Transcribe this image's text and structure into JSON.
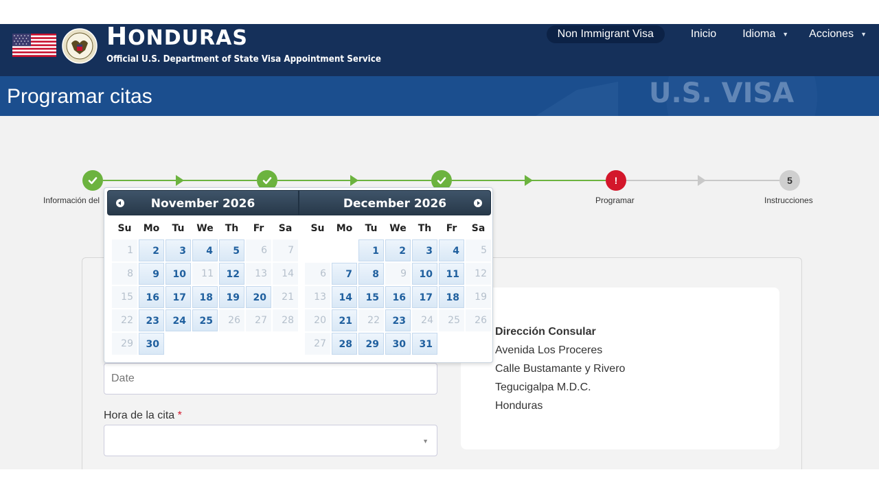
{
  "header": {
    "brand_first": "H",
    "brand_rest": "ONDURAS",
    "subtitle": "Official U.S. Department of State Visa Appointment Service",
    "nav": {
      "pill": "Non Immigrant Visa",
      "home": "Inicio",
      "language": "Idioma",
      "actions": "Acciones"
    },
    "watermark_text": "U.S. VISA"
  },
  "page": {
    "title": "Programar citas"
  },
  "stepper": {
    "steps": [
      {
        "label": "Información del",
        "status": "done"
      },
      {
        "label": "",
        "status": "done"
      },
      {
        "label": "",
        "status": "done"
      },
      {
        "label": "Programar",
        "status": "error",
        "mark": "!"
      },
      {
        "label": "Instrucciones",
        "status": "pending",
        "mark": "5"
      }
    ]
  },
  "datepicker": {
    "weekdays": [
      "Su",
      "Mo",
      "Tu",
      "We",
      "Th",
      "Fr",
      "Sa"
    ],
    "months": [
      {
        "title": "November 2026",
        "weeks": [
          [
            [
              "1",
              "off"
            ],
            [
              "2",
              "avail"
            ],
            [
              "3",
              "avail"
            ],
            [
              "4",
              "avail"
            ],
            [
              "5",
              "avail"
            ],
            [
              "6",
              "off"
            ],
            [
              "7",
              "off"
            ]
          ],
          [
            [
              "8",
              "off"
            ],
            [
              "9",
              "avail"
            ],
            [
              "10",
              "avail"
            ],
            [
              "11",
              "off"
            ],
            [
              "12",
              "avail"
            ],
            [
              "13",
              "off"
            ],
            [
              "14",
              "off"
            ]
          ],
          [
            [
              "15",
              "off"
            ],
            [
              "16",
              "avail"
            ],
            [
              "17",
              "avail"
            ],
            [
              "18",
              "avail"
            ],
            [
              "19",
              "avail"
            ],
            [
              "20",
              "avail"
            ],
            [
              "21",
              "off"
            ]
          ],
          [
            [
              "22",
              "off"
            ],
            [
              "23",
              "avail"
            ],
            [
              "24",
              "avail"
            ],
            [
              "25",
              "avail"
            ],
            [
              "26",
              "off"
            ],
            [
              "27",
              "off"
            ],
            [
              "28",
              "off"
            ]
          ],
          [
            [
              "29",
              "off"
            ],
            [
              "30",
              "avail"
            ],
            [
              "",
              ""
            ],
            [
              "",
              ""
            ],
            [
              "",
              ""
            ],
            [
              "",
              ""
            ],
            [
              "",
              ""
            ]
          ]
        ]
      },
      {
        "title": "December 2026",
        "weeks": [
          [
            [
              "",
              ""
            ],
            [
              "",
              ""
            ],
            [
              "1",
              "avail"
            ],
            [
              "2",
              "avail"
            ],
            [
              "3",
              "avail"
            ],
            [
              "4",
              "avail"
            ],
            [
              "5",
              "off"
            ]
          ],
          [
            [
              "6",
              "off"
            ],
            [
              "7",
              "avail"
            ],
            [
              "8",
              "avail"
            ],
            [
              "9",
              "off"
            ],
            [
              "10",
              "avail"
            ],
            [
              "11",
              "avail"
            ],
            [
              "12",
              "off"
            ]
          ],
          [
            [
              "13",
              "off"
            ],
            [
              "14",
              "avail"
            ],
            [
              "15",
              "avail"
            ],
            [
              "16",
              "avail"
            ],
            [
              "17",
              "avail"
            ],
            [
              "18",
              "avail"
            ],
            [
              "19",
              "off"
            ]
          ],
          [
            [
              "20",
              "off"
            ],
            [
              "21",
              "avail"
            ],
            [
              "22",
              "off"
            ],
            [
              "23",
              "avail"
            ],
            [
              "24",
              "off"
            ],
            [
              "25",
              "off"
            ],
            [
              "26",
              "off"
            ]
          ],
          [
            [
              "27",
              "off"
            ],
            [
              "28",
              "avail"
            ],
            [
              "29",
              "avail"
            ],
            [
              "30",
              "avail"
            ],
            [
              "31",
              "avail"
            ],
            [
              "",
              ""
            ],
            [
              "",
              ""
            ]
          ]
        ]
      }
    ]
  },
  "form": {
    "date_placeholder": "Date",
    "time_label": "Hora de la cita",
    "required_mark": "*"
  },
  "address": {
    "heading": "Dirección Consular",
    "lines": [
      "Avenida Los Proceres",
      "Calle Bustamante y Rivero",
      "Tegucigalpa M.D.C.",
      "Honduras"
    ]
  },
  "colors": {
    "header_bg": "#15305a",
    "title_band_bg": "#1b4e8e",
    "step_done": "#6cb33f",
    "step_error": "#d3172b",
    "step_pending": "#cfcfcf",
    "available_day_text": "#1f5f9e"
  }
}
